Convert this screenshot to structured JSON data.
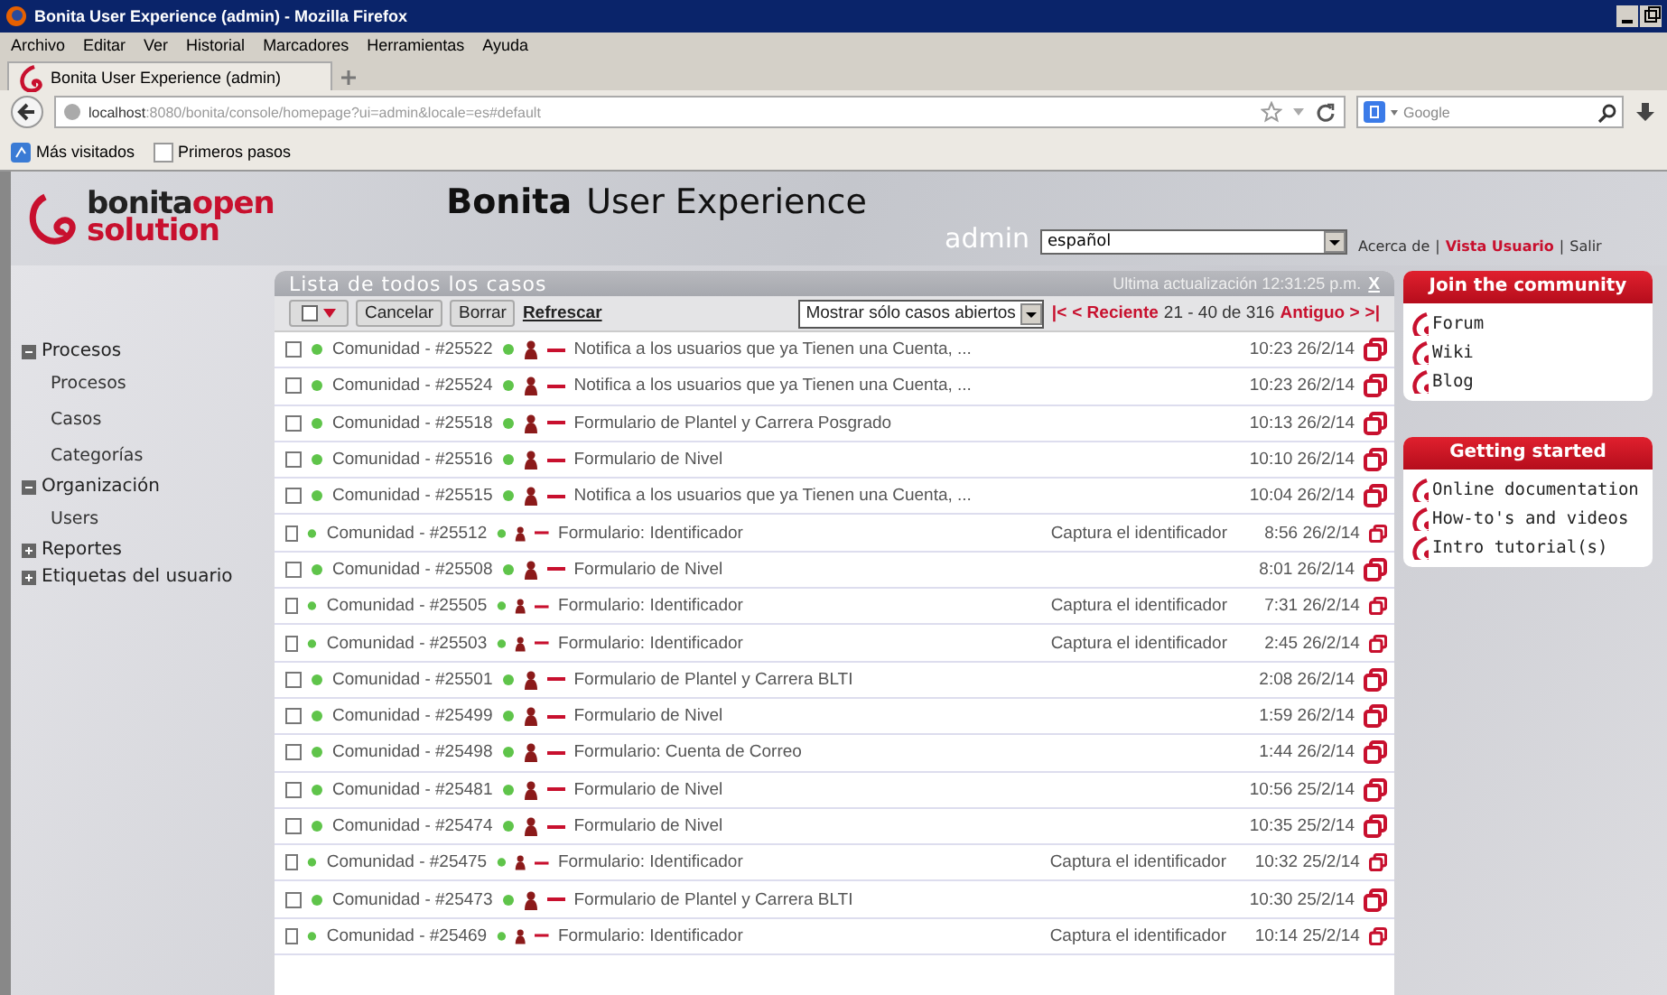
{
  "window": {
    "title": "Bonita User Experience (admin) - Mozilla Firefox"
  },
  "menu_bar": [
    "Archivo",
    "Editar",
    "Ver",
    "Historial",
    "Marcadores",
    "Herramientas",
    "Ayuda"
  ],
  "tabs": [
    {
      "label": "Bonita User Experience (admin)",
      "selected": true
    }
  ],
  "address_bar": {
    "host": "localhost",
    "path": ":8080/bonita/console/homepage?ui=admin&locale=es#default"
  },
  "search": {
    "placeholder": "Google"
  },
  "bookmarks": [
    "Más visitados",
    "Primeros pasos"
  ],
  "header": {
    "logo_top": "bonita",
    "logo_accent": "open",
    "logo_bottom": "solution",
    "title_bold": "Bonita",
    "title_rest": "User Experience",
    "user": "admin",
    "language": "español",
    "links": [
      {
        "label": "Acerca de",
        "highlight": false
      },
      {
        "label": "Vista Usuario",
        "highlight": true
      },
      {
        "label": "Salir",
        "highlight": false
      }
    ],
    "separator": "|"
  },
  "sidebar": {
    "items": [
      {
        "label": "Procesos",
        "expanded": true,
        "children": [
          {
            "label": "Procesos"
          },
          {
            "label": "Casos"
          },
          {
            "label": "Categorías"
          }
        ]
      },
      {
        "label": "Organización",
        "expanded": true,
        "children": [
          {
            "label": "Users"
          }
        ]
      },
      {
        "label": "Reportes",
        "expanded": false
      },
      {
        "label": "Etiquetas del usuario",
        "expanded": false
      }
    ]
  },
  "case_list": {
    "title": "Lista de todos los casos",
    "last_update": "Ultima actualización 12:31:25 p.m.",
    "close": "X",
    "buttons": [
      "Cancelar",
      "Borrar"
    ],
    "refresh": "Refrescar",
    "filter": "Mostrar sólo casos abiertos",
    "pager": {
      "first": "|<",
      "newer": "< Reciente",
      "range": "21 - 40 de 316",
      "older": "Antiguo >",
      "last": ">|"
    },
    "rows": [
      {
        "checked": false,
        "case": "Comunidad - #25522",
        "task": "Notifica a los usuarios que ya Tienen una Cuenta, ...",
        "date": "10:23 26/2/14"
      },
      {
        "checked": false,
        "case": "Comunidad - #25524",
        "task": "Notifica a los usuarios que ya Tienen una Cuenta, ...",
        "date": "10:23 26/2/14"
      },
      {
        "checked": false,
        "case": "Comunidad - #25518",
        "task": "Formulario de Plantel y Carrera Posgrado",
        "date": "10:13 26/2/14"
      },
      {
        "checked": false,
        "case": "Comunidad - #25516",
        "task": "Formulario de Nivel",
        "date": "10:10 26/2/14"
      },
      {
        "checked": false,
        "case": "Comunidad - #25515",
        "task": "Notifica a los usuarios que ya Tienen una Cuenta, ...",
        "date": "10:04 26/2/14"
      },
      {
        "checked": false,
        "case": "Comunidad - #25512",
        "task": "Formulario: Identificador",
        "note": "Captura el identificador",
        "date": "8:56 26/2/14"
      },
      {
        "checked": false,
        "case": "Comunidad - #25508",
        "task": "Formulario de Nivel",
        "date": "8:01 26/2/14"
      },
      {
        "checked": false,
        "case": "Comunidad - #25505",
        "task": "Formulario: Identificador",
        "note": "Captura el identificador",
        "date": "7:31 26/2/14"
      },
      {
        "checked": false,
        "case": "Comunidad - #25503",
        "task": "Formulario: Identificador",
        "note": "Captura el identificador",
        "date": "2:45 26/2/14"
      },
      {
        "checked": false,
        "case": "Comunidad - #25501",
        "task": "Formulario de Plantel y Carrera BLTI",
        "date": "2:08 26/2/14"
      },
      {
        "checked": false,
        "case": "Comunidad - #25499",
        "task": "Formulario de Nivel",
        "date": "1:59 26/2/14"
      },
      {
        "checked": false,
        "case": "Comunidad - #25498",
        "task": "Formulario: Cuenta de Correo",
        "date": "1:44 26/2/14"
      },
      {
        "checked": false,
        "case": "Comunidad - #25481",
        "task": "Formulario de Nivel",
        "date": "10:56 25/2/14"
      },
      {
        "checked": false,
        "case": "Comunidad - #25474",
        "task": "Formulario de Nivel",
        "date": "10:35 25/2/14"
      },
      {
        "checked": false,
        "case": "Comunidad - #25475",
        "task": "Formulario: Identificador",
        "note": "Captura el identificador",
        "date": "10:32 25/2/14"
      },
      {
        "checked": false,
        "case": "Comunidad - #25473",
        "task": "Formulario de Plantel y Carrera BLTI",
        "date": "10:30 25/2/14"
      },
      {
        "checked": false,
        "case": "Comunidad - #25469",
        "task": "Formulario: Identificador",
        "note": "Captura el identificador",
        "date": "10:14 25/2/14"
      }
    ]
  },
  "side_boxes": [
    {
      "title": "Join the community",
      "links": [
        "Forum",
        "Wiki",
        "Blog"
      ]
    },
    {
      "title": "Getting started",
      "links": [
        "Online documentation",
        "How-to's and videos",
        "Intro tutorial(s)"
      ]
    }
  ]
}
